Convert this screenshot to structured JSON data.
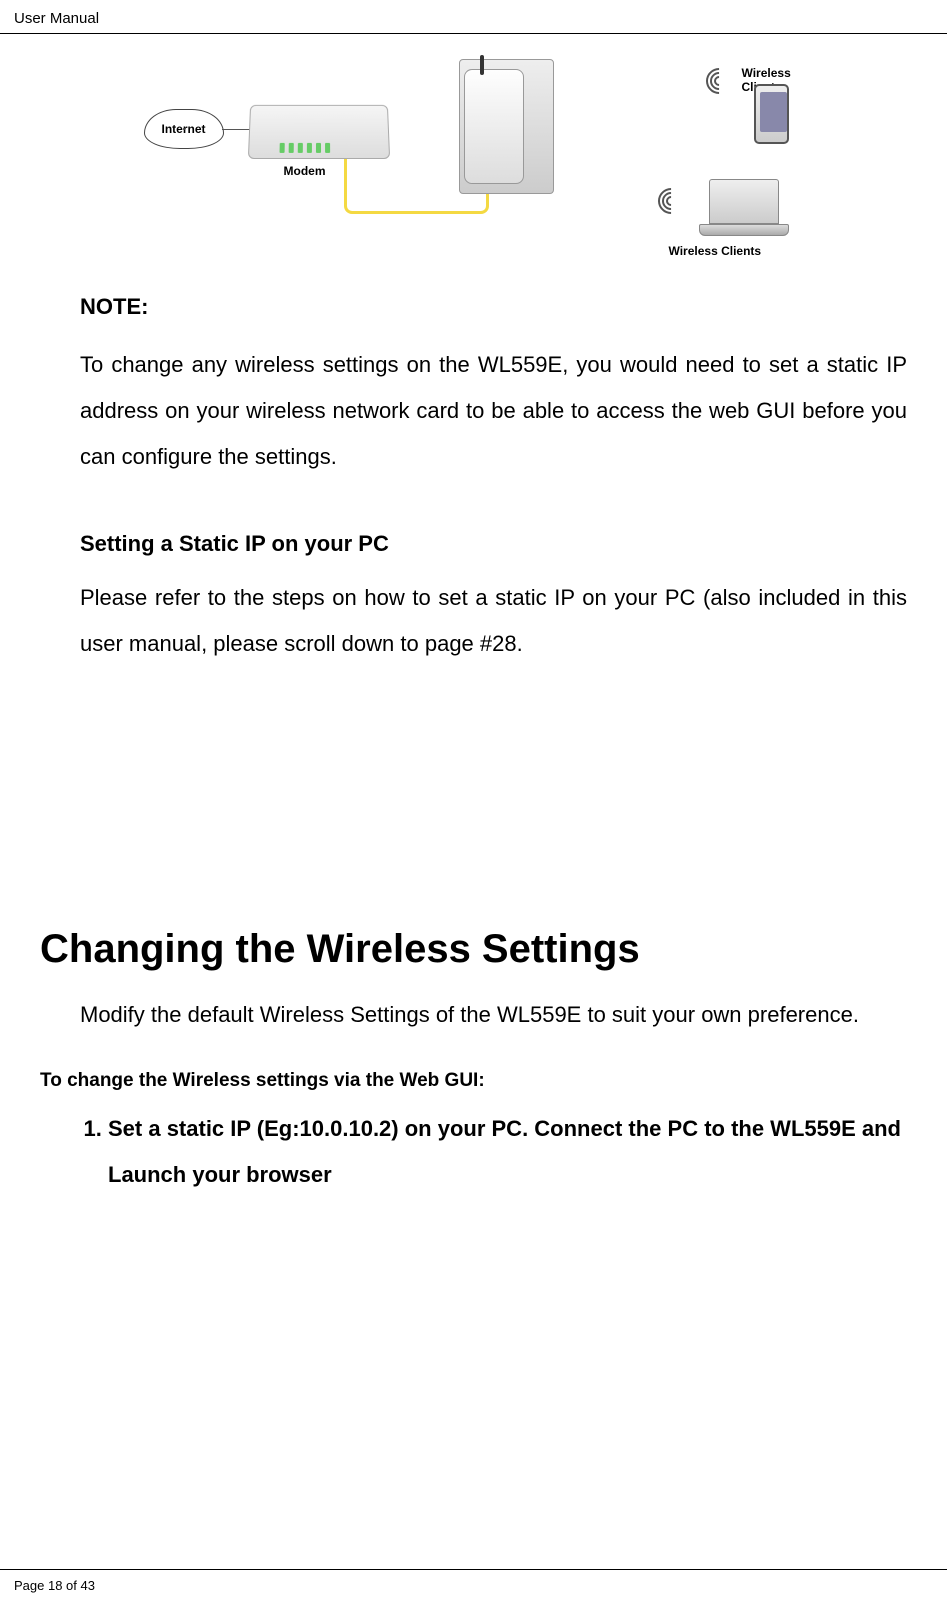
{
  "header": {
    "title": "User Manual"
  },
  "diagram": {
    "internet_label": "Internet",
    "modem_label": "Modem",
    "wireless_clients_top": "Wireless Clients",
    "wireless_clients_bot": "Wireless Clients"
  },
  "body": {
    "note_heading": "NOTE:",
    "note_para": "To change any wireless settings on the WL559E, you would need to set a static IP address on your wireless network card to be able to access the web GUI before you can configure the settings.",
    "static_ip_heading": "Setting a Static IP on your PC",
    "static_ip_para": "Please refer to the steps on how to set a static IP on your PC (also included in this user manual, please scroll down to page #28.",
    "section_title": "Changing the Wireless Settings",
    "section_intro": "Modify the default Wireless Settings of the WL559E to suit your own preference.",
    "subsection_heading": "To change the Wireless settings via the Web GUI:",
    "step_1": "Set a static IP (Eg:10.0.10.2) on your PC. Connect the PC to the WL559E and Launch your browser"
  },
  "footer": {
    "page_label": "Page 18 of 43"
  }
}
